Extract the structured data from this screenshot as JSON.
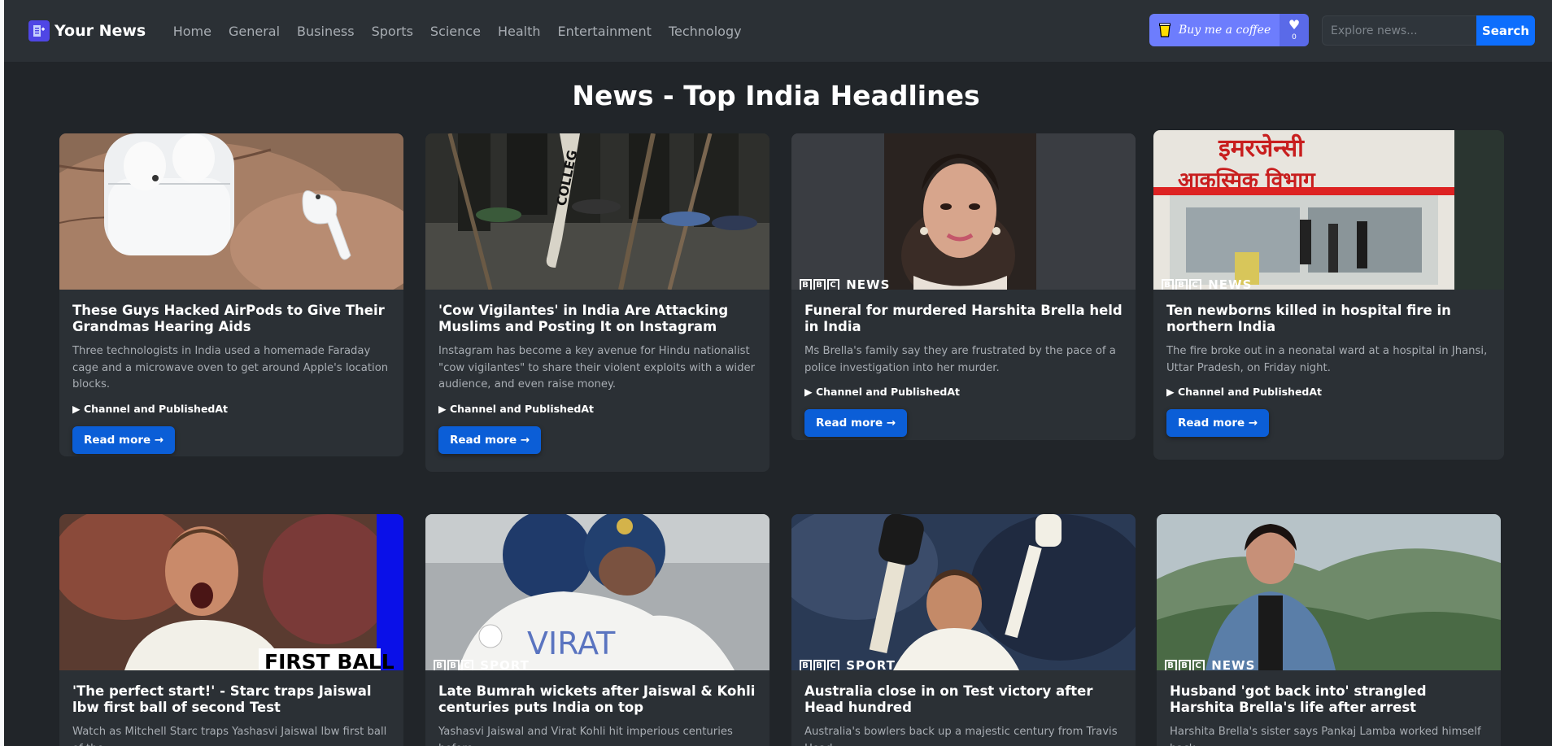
{
  "brand": {
    "name": "Your News",
    "icon": "news-logo-icon"
  },
  "nav": {
    "links": [
      "Home",
      "General",
      "Business",
      "Sports",
      "Science",
      "Health",
      "Entertainment",
      "Technology"
    ]
  },
  "coffee": {
    "label": "Buy me a coffee",
    "count": "0",
    "icon": "coffee-cup-icon",
    "heart_icon": "heart-icon"
  },
  "search": {
    "placeholder": "Explore news...",
    "button_label": "Search"
  },
  "page": {
    "title": "News - Top India Headlines"
  },
  "colors": {
    "background": "#212529",
    "navbar": "#2b3035",
    "card": "#2b3035",
    "primary_button": "#0b5ed7",
    "search_button": "#0d6efd",
    "coffee": "#6d7dfd"
  },
  "articles": [
    {
      "title": "These Guys Hacked AirPods to Give Their Grandmas Hearing Aids",
      "description": "Three technologists in India used a homemade Faraday cage and a microwave oven to get around Apple's location blocks.",
      "details_label": "Channel and PublishedAt",
      "button_label": "Read more →"
    },
    {
      "title": "'Cow Vigilantes' in India Are Attacking Muslims and Posting It on Instagram",
      "description": "Instagram has become a key avenue for Hindu nationalist \"cow vigilantes\" to share their violent exploits with a wider audience, and even raise money.",
      "details_label": "Channel and PublishedAt",
      "button_label": "Read more →"
    },
    {
      "title": "Funeral for murdered Harshita Brella held in India",
      "description": "Ms Brella's family say they are frustrated by the pace of a police investigation into her murder.",
      "details_label": "Channel and PublishedAt",
      "button_label": "Read more →",
      "image_label": "NEWS"
    },
    {
      "title": "Ten newborns killed in hospital fire in northern India",
      "description": "The fire broke out in a neonatal ward at a hospital in Jhansi, Uttar Pradesh, on Friday night.",
      "details_label": "Channel and PublishedAt",
      "button_label": "Read more →",
      "image_label": "NEWS",
      "sign_text_1": "इमरजेन्सी",
      "sign_text_2": "आकस्मिक विभाग"
    },
    {
      "title": "'The perfect start!' - Starc traps Jaiswal lbw first ball of second Test",
      "description": "Watch as Mitchell Starc traps Yashasvi Jaiswal lbw first ball of the",
      "image_label": "FIRST BALL"
    },
    {
      "title": "Late Bumrah wickets after Jaiswal & Kohli centuries puts India on top",
      "description": "Yashasvi Jaiswal and Virat Kohli hit imperious centuries before",
      "image_label": "SPORT",
      "shirt_text": "VIRAT"
    },
    {
      "title": "Australia close in on Test victory after Head hundred",
      "description": "Australia's bowlers back up a majestic century from Travis Head",
      "image_label": "SPORT"
    },
    {
      "title": "Husband 'got back into' strangled Harshita Brella's life after arrest",
      "description": "Harshita Brella's sister says Pankaj Lamba worked himself back",
      "image_label": "NEWS"
    }
  ]
}
